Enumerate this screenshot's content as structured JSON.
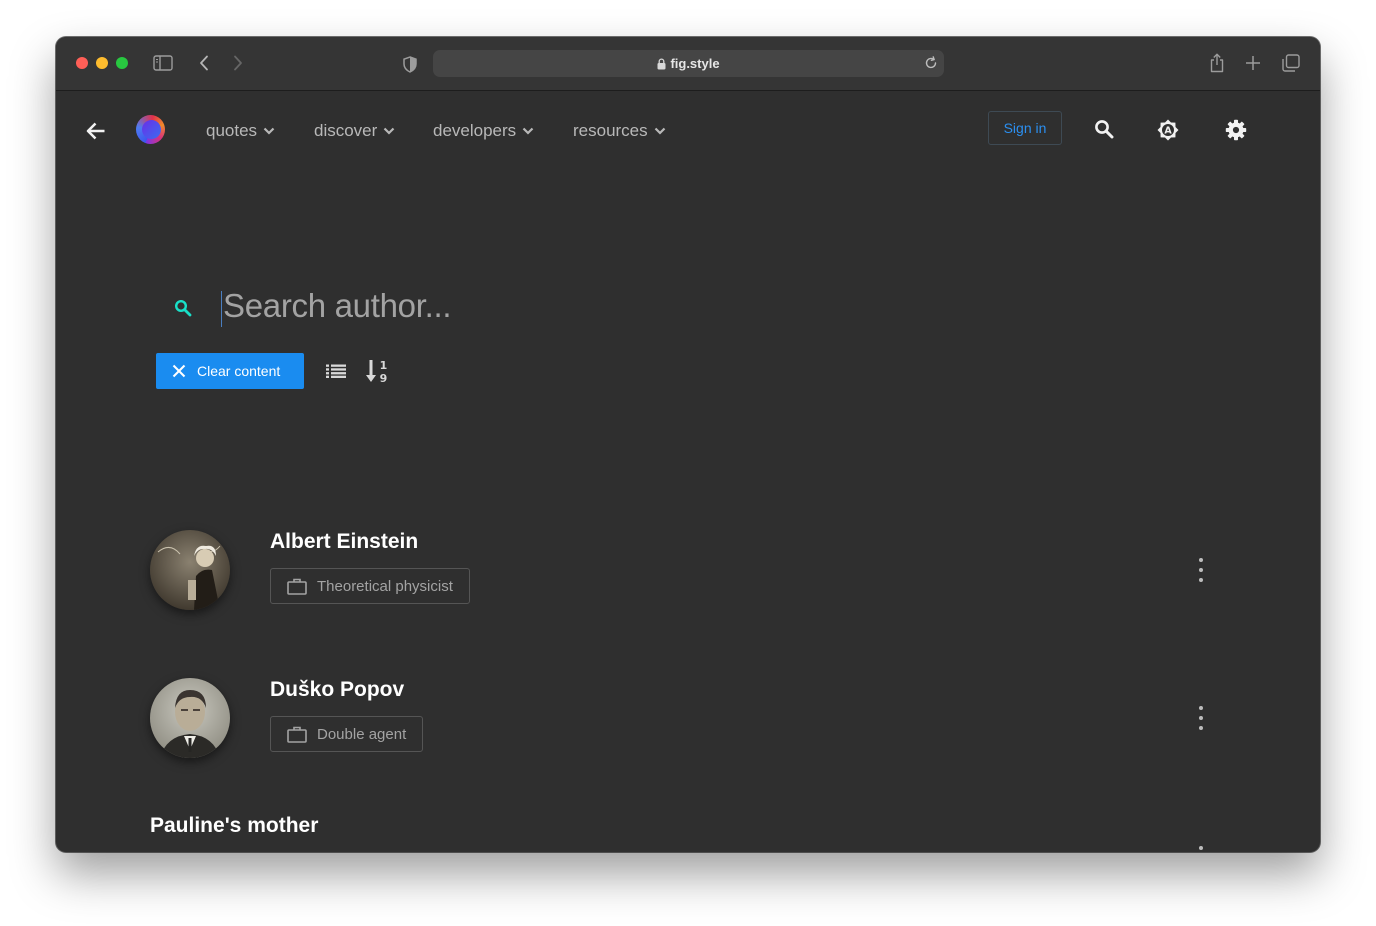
{
  "browser": {
    "url": "fig.style"
  },
  "nav": {
    "menus": [
      {
        "label": "quotes"
      },
      {
        "label": "discover"
      },
      {
        "label": "developers"
      },
      {
        "label": "resources"
      }
    ],
    "sign_in_label": "Sign in"
  },
  "search": {
    "placeholder": "Search author...",
    "clear_label": "Clear content"
  },
  "authors": [
    {
      "name": "Albert Einstein",
      "job": "Theoretical physicist"
    },
    {
      "name": "Duško Popov",
      "job": "Double agent"
    },
    {
      "name": "Pauline's mother"
    }
  ],
  "colors": {
    "background": "#2f2f2f",
    "accent_blue": "#1a8cf0",
    "search_icon": "#19e0c8",
    "sign_in_text": "#2b8ff0"
  }
}
